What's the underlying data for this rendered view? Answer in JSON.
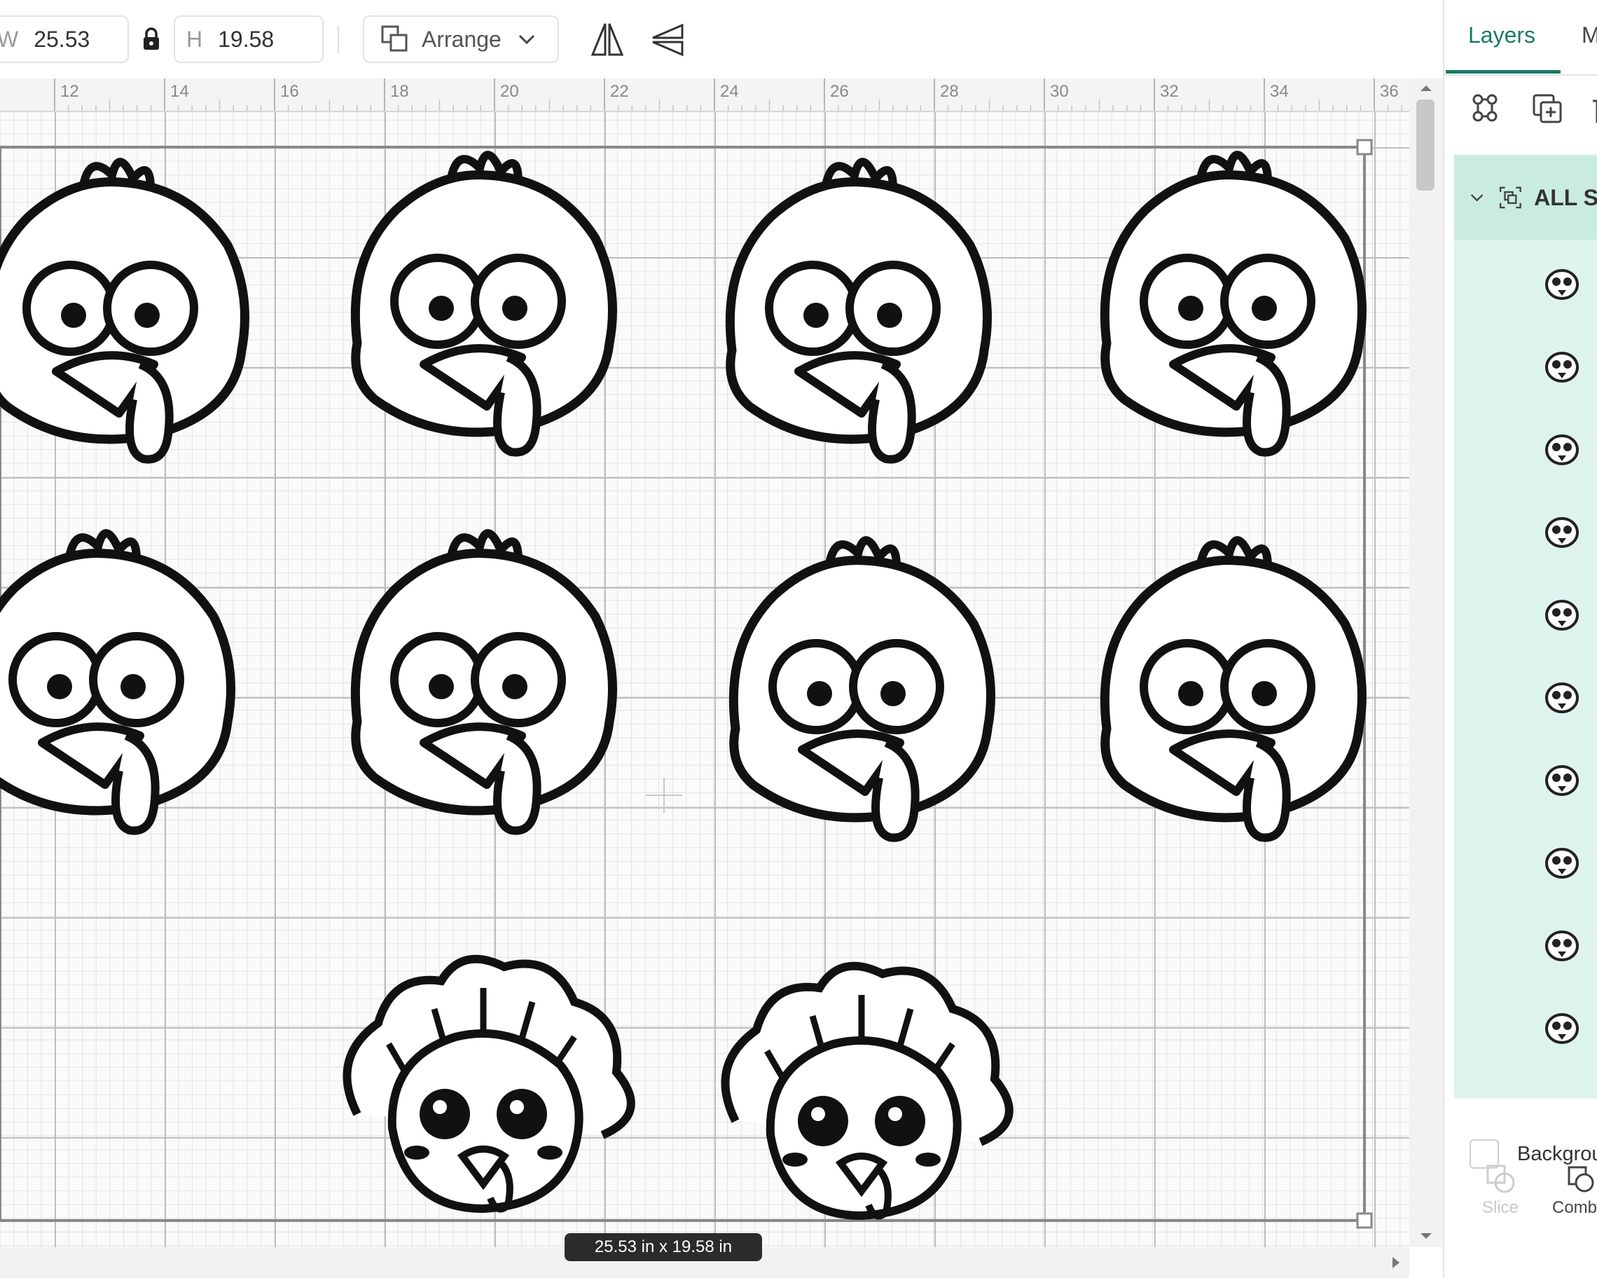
{
  "toolbar": {
    "width": {
      "label": "W",
      "value": "25.53"
    },
    "height": {
      "label": "H",
      "value": "19.58"
    },
    "arrange_label": "Arrange"
  },
  "ruler": {
    "ticks": [
      "12",
      "14",
      "16",
      "18",
      "20",
      "22",
      "24",
      "26",
      "28",
      "30",
      "32",
      "34",
      "36"
    ]
  },
  "size_badge": "25.53 in x 19.58 in",
  "panel": {
    "tabs": [
      {
        "label": "Layers",
        "active": true
      },
      {
        "label": "M",
        "active": false
      }
    ],
    "group_name": "ALL S",
    "layer_count": 10,
    "background_label": "Backgroun",
    "bottom_tools": [
      {
        "label": "Slice",
        "enabled": false
      },
      {
        "label": "Comb",
        "enabled": true
      }
    ]
  },
  "canvas_content": {
    "description_items": 10,
    "icon": "turkey-head-icon"
  },
  "colors": {
    "accent": "#1a7a66",
    "group_bg": "#dff3ee",
    "group_header": "#c9ebe2",
    "stroke": "#111111"
  }
}
